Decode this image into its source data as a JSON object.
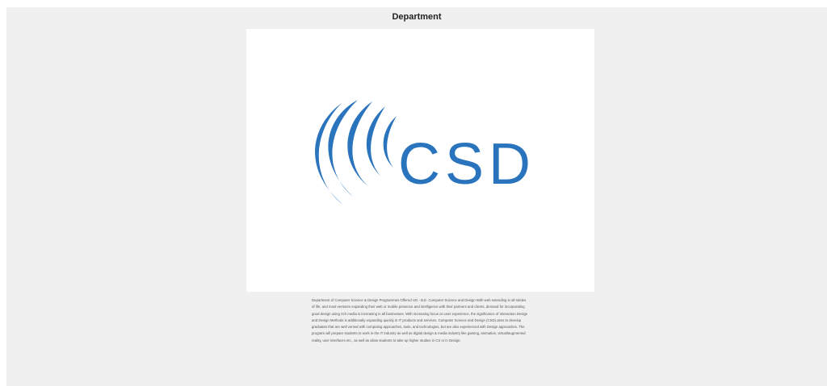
{
  "page": {
    "title": "Department"
  },
  "logo": {
    "text": "CSD",
    "brand_color": "#2a73bd",
    "icon": "swoosh-icon"
  },
  "description": "Department of Computer Science & Design Programmes Offered UG - B.E. Computer Science and Design With web extending in all strides of life, and most ventures expanding their web or mobile presence and intelligence with their partners and clients, demand for incorporating good design using rich media is increasing in all businesses. With increasing focus on user experience, the significance of Interaction Design and Design Methods is additionally expanding quickly in IT products and services. Computer Science and Design (CSD) aims to develop graduates that are well versed with computing approaches, tools, and technologies, but are also experienced with Design approaches. The program will prepare students to work in the IT industry as well as digital design & media industry like gaming, animation, virtual/augmented reality, user interfaces etc., as well as allow students to take up higher studies in CS or in Design."
}
